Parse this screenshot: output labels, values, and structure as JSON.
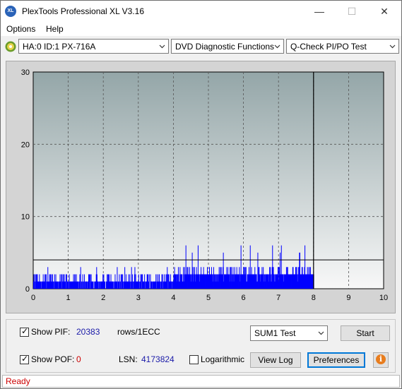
{
  "window": {
    "title": "PlexTools Professional XL V3.16",
    "icon_text": "XL"
  },
  "menu": {
    "options": "Options",
    "help": "Help"
  },
  "toolbar": {
    "drive": "HA:0 ID:1  PX-716A",
    "function": "DVD Diagnostic Functions",
    "test": "Q-Check PI/PO Test"
  },
  "chart_data": {
    "type": "bar",
    "title": "",
    "xlabel": "",
    "ylabel": "",
    "xlim": [
      0,
      10
    ],
    "ylim": [
      0,
      30
    ],
    "x_ticks": [
      "0",
      "1",
      "2",
      "3",
      "4",
      "5",
      "6",
      "7",
      "8",
      "9",
      "10"
    ],
    "y_ticks": [
      "0",
      "10",
      "20",
      "30"
    ],
    "threshold": 4,
    "end_marker_x": 8,
    "grid": true,
    "series": [
      {
        "color": "#0000ff",
        "segments": [
          {
            "x_range": [
              0.0,
              4.0
            ],
            "typical_value": 1,
            "peak_value": 3
          },
          {
            "x_range": [
              4.0,
              8.0
            ],
            "typical_value": 2,
            "peak_value": 6
          }
        ]
      }
    ]
  },
  "controls": {
    "show_pif_label": "Show PIF:",
    "pif_value": "20383",
    "pif_unit": "rows/1ECC",
    "show_pof_label": "Show POF:",
    "pof_value": "0",
    "lsn_label": "LSN:",
    "lsn_value": "4173824",
    "logarithmic_label": "Logarithmic",
    "sum_select": "SUM1 Test",
    "start_button": "Start",
    "view_log_button": "View Log",
    "preferences_button": "Preferences"
  },
  "status": {
    "text": "Ready"
  },
  "colors": {
    "plot_bg_top": "#94a6a8",
    "plot_bg_bottom": "#f8f8f8",
    "pif_value": "#1a1aa8",
    "pof_value": "#cc0000",
    "status_text": "#cc0000"
  }
}
